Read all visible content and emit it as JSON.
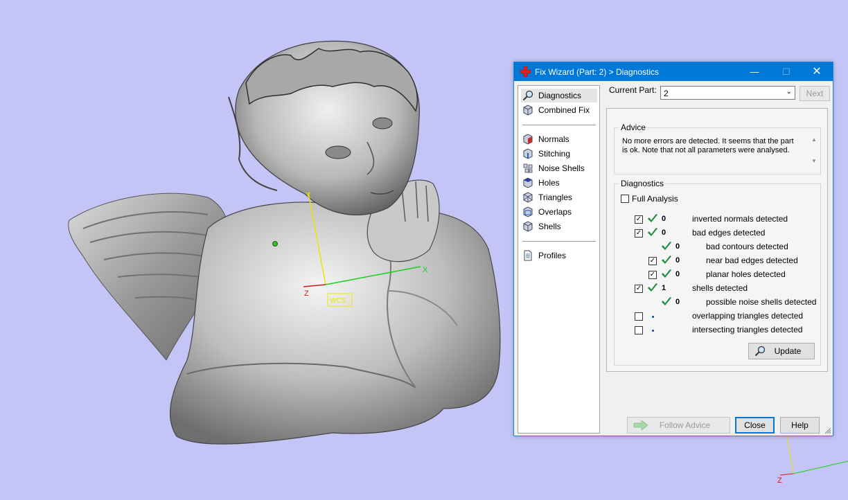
{
  "viewport": {
    "background": "#c4c4f7",
    "axis_labels": {
      "y": "Y",
      "x": "X",
      "z": "Z",
      "wcs": "WCS"
    },
    "corner_axis": {
      "z": "Z"
    }
  },
  "dialog": {
    "title": "Fix Wizard (Part: 2) > Diagnostics",
    "title_icon": "red-cross-icon",
    "titlebar_color": "#0078d7",
    "window_buttons": {
      "minimize": "—",
      "maximize": "☐",
      "close": "✕"
    },
    "nav": {
      "items": [
        {
          "label": "Diagnostics",
          "icon": "magnifier-icon",
          "selected": true
        },
        {
          "label": "Combined Fix",
          "icon": "cube-icon"
        },
        {
          "label": "Normals",
          "icon": "normals-cube-icon"
        },
        {
          "label": "Stitching",
          "icon": "stitching-cube-icon"
        },
        {
          "label": "Noise Shells",
          "icon": "noise-shells-icon"
        },
        {
          "label": "Holes",
          "icon": "holes-cube-icon"
        },
        {
          "label": "Triangles",
          "icon": "triangles-cube-icon"
        },
        {
          "label": "Overlaps",
          "icon": "overlaps-cube-icon"
        },
        {
          "label": "Shells",
          "icon": "shells-cube-icon"
        },
        {
          "label": "Profiles",
          "icon": "document-icon"
        }
      ]
    },
    "current_part": {
      "label": "Current Part:",
      "value": "2"
    },
    "next_label": "Next",
    "advice": {
      "title": "Advice",
      "text": "No more errors are detected. It seems that the part is ok. Note that not all parameters were analysed."
    },
    "diagnostics": {
      "title": "Diagnostics",
      "full_analysis": {
        "label": "Full Analysis",
        "checked": false
      },
      "rows": [
        {
          "checkbox": true,
          "checked": true,
          "status": "ok",
          "count": "0",
          "label": "inverted normals detected",
          "indent": 0
        },
        {
          "checkbox": true,
          "checked": true,
          "status": "ok",
          "count": "0",
          "label": "bad edges detected",
          "indent": 0
        },
        {
          "checkbox": false,
          "status": "ok",
          "count": "0",
          "label": "bad contours detected",
          "indent": 1
        },
        {
          "checkbox": true,
          "checked": true,
          "status": "ok",
          "count": "0",
          "label": "near bad edges detected",
          "indent": 1
        },
        {
          "checkbox": true,
          "checked": true,
          "status": "ok",
          "count": "0",
          "label": "planar holes detected",
          "indent": 1
        },
        {
          "checkbox": true,
          "checked": true,
          "status": "ok",
          "count": "1",
          "label": "shells detected",
          "indent": 0
        },
        {
          "checkbox": false,
          "status": "ok",
          "count": "0",
          "label": "possible noise shells detected",
          "indent": 1
        },
        {
          "checkbox": true,
          "checked": false,
          "status": "none",
          "count": "",
          "label": "overlapping triangles detected",
          "indent": 0
        },
        {
          "checkbox": true,
          "checked": false,
          "status": "none",
          "count": "",
          "label": "intersecting triangles detected",
          "indent": 0
        }
      ],
      "update_label": "Update"
    },
    "footer": {
      "follow_advice_label": "Follow Advice",
      "close_label": "Close",
      "help_label": "Help"
    }
  }
}
